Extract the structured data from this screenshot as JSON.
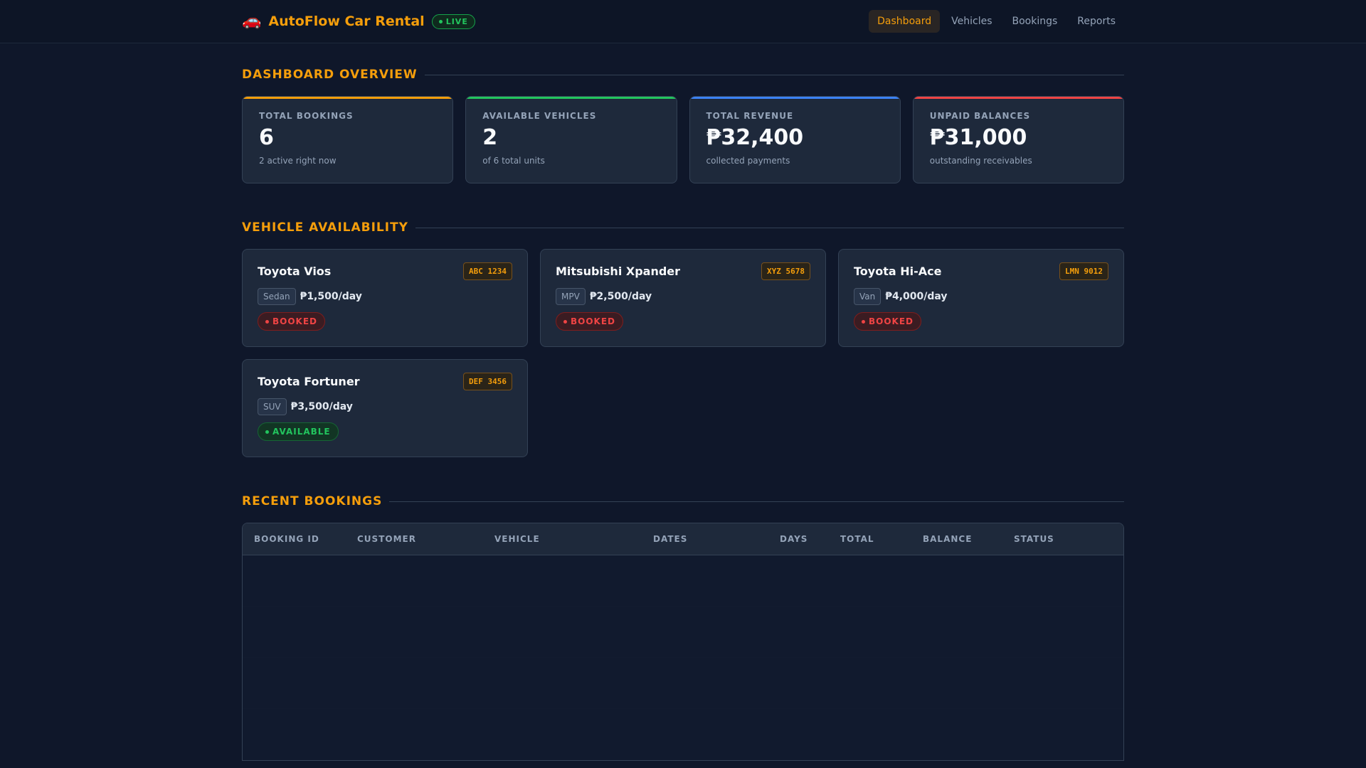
{
  "header": {
    "brand_icon": "🚗",
    "title": "AutoFlow Car Rental",
    "live_label": "LIVE",
    "nav": [
      {
        "label": "Dashboard",
        "active": true
      },
      {
        "label": "Vehicles",
        "active": false
      },
      {
        "label": "Bookings",
        "active": false
      },
      {
        "label": "Reports",
        "active": false
      }
    ]
  },
  "overview": {
    "title": "DASHBOARD OVERVIEW",
    "stats": [
      {
        "label": "TOTAL BOOKINGS",
        "value": "6",
        "sub": "2 active right now",
        "accent": "#f59e0b"
      },
      {
        "label": "AVAILABLE VEHICLES",
        "value": "2",
        "sub": "of 6 total units",
        "accent": "#22c55e"
      },
      {
        "label": "TOTAL REVENUE",
        "value": "₱32,400",
        "sub": "collected payments",
        "accent": "#3b82f6"
      },
      {
        "label": "UNPAID BALANCES",
        "value": "₱31,000",
        "sub": "outstanding receivables",
        "accent": "#ef4444"
      }
    ]
  },
  "availability": {
    "title": "VEHICLE AVAILABILITY",
    "vehicles": [
      {
        "name": "Toyota Vios",
        "plate": "ABC 1234",
        "type": "Sedan",
        "price": "₱1,500/day",
        "status": "BOOKED"
      },
      {
        "name": "Mitsubishi Xpander",
        "plate": "XYZ 5678",
        "type": "MPV",
        "price": "₱2,500/day",
        "status": "BOOKED"
      },
      {
        "name": "Toyota Hi-Ace",
        "plate": "LMN 9012",
        "type": "Van",
        "price": "₱4,000/day",
        "status": "BOOKED"
      },
      {
        "name": "Toyota Fortuner",
        "plate": "DEF 3456",
        "type": "SUV",
        "price": "₱3,500/day",
        "status": "AVAILABLE"
      }
    ]
  },
  "bookings": {
    "title": "RECENT BOOKINGS",
    "columns": [
      "BOOKING ID",
      "CUSTOMER",
      "VEHICLE",
      "DATES",
      "DAYS",
      "TOTAL",
      "BALANCE",
      "STATUS"
    ],
    "rows": [
      [
        "",
        "",
        "",
        "",
        "",
        "",
        "",
        ""
      ],
      [
        "",
        "",
        "",
        "",
        "",
        "",
        "",
        ""
      ],
      [
        "",
        "",
        "",
        "",
        "",
        "",
        "",
        ""
      ],
      [
        "",
        "",
        "",
        "",
        "",
        "",
        "",
        ""
      ]
    ]
  }
}
